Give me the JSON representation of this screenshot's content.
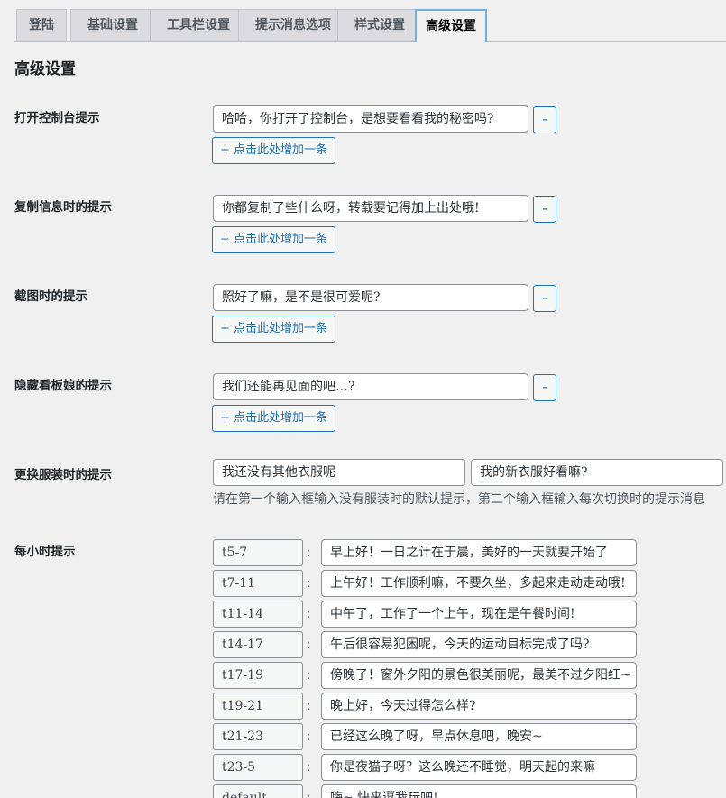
{
  "tabs": [
    "登陆",
    "基础设置",
    "工具栏设置",
    "提示消息选项",
    "样式设置",
    "高级设置"
  ],
  "active_tab": "高级设置",
  "section_title": "高级设置",
  "add_label": "+ 点击此处增加一条",
  "remove_label": "-",
  "console_tip": {
    "label": "打开控制台提示",
    "value": "哈哈，你打开了控制台，是想要看看我的秘密吗?"
  },
  "copy_tip": {
    "label": "复制信息时的提示",
    "value": "你都复制了些什么呀，转载要记得加上出处哦!"
  },
  "screenshot_tip": {
    "label": "截图时的提示",
    "value": "照好了嘛，是不是很可爱呢?"
  },
  "hide_tip": {
    "label": "隐藏看板娘的提示",
    "value": "我们还能再见面的吧…?"
  },
  "costume_tip": {
    "label": "更换服装时的提示",
    "value1": "我还没有其他衣服呢",
    "value2": "我的新衣服好看嘛?",
    "description": "请在第一个输入框输入没有服装时的默认提示，第二个输入框输入每次切换时的提示消息"
  },
  "hourly_tip": {
    "label": "每小时提示",
    "colon": ":",
    "rows": [
      {
        "key": "t5-7",
        "value": "早上好！一日之计在于晨，美好的一天就要开始了"
      },
      {
        "key": "t7-11",
        "value": "上午好！工作顺利嘛，不要久坐，多起来走动走动哦!"
      },
      {
        "key": "t11-14",
        "value": "中午了，工作了一个上午，现在是午餐时间!"
      },
      {
        "key": "t14-17",
        "value": "午后很容易犯困呢，今天的运动目标完成了吗?"
      },
      {
        "key": "t17-19",
        "value": "傍晚了！窗外夕阳的景色很美丽呢，最美不过夕阳红~"
      },
      {
        "key": "t19-21",
        "value": "晚上好，今天过得怎么样?"
      },
      {
        "key": "t21-23",
        "value": "已经这么晚了呀，早点休息吧，晚安~"
      },
      {
        "key": "t23-5",
        "value": "你是夜猫子呀？这么晚还不睡觉，明天起的来嘛"
      },
      {
        "key": "default",
        "value": "嗨~ 快来逗我玩吧!"
      }
    ]
  }
}
